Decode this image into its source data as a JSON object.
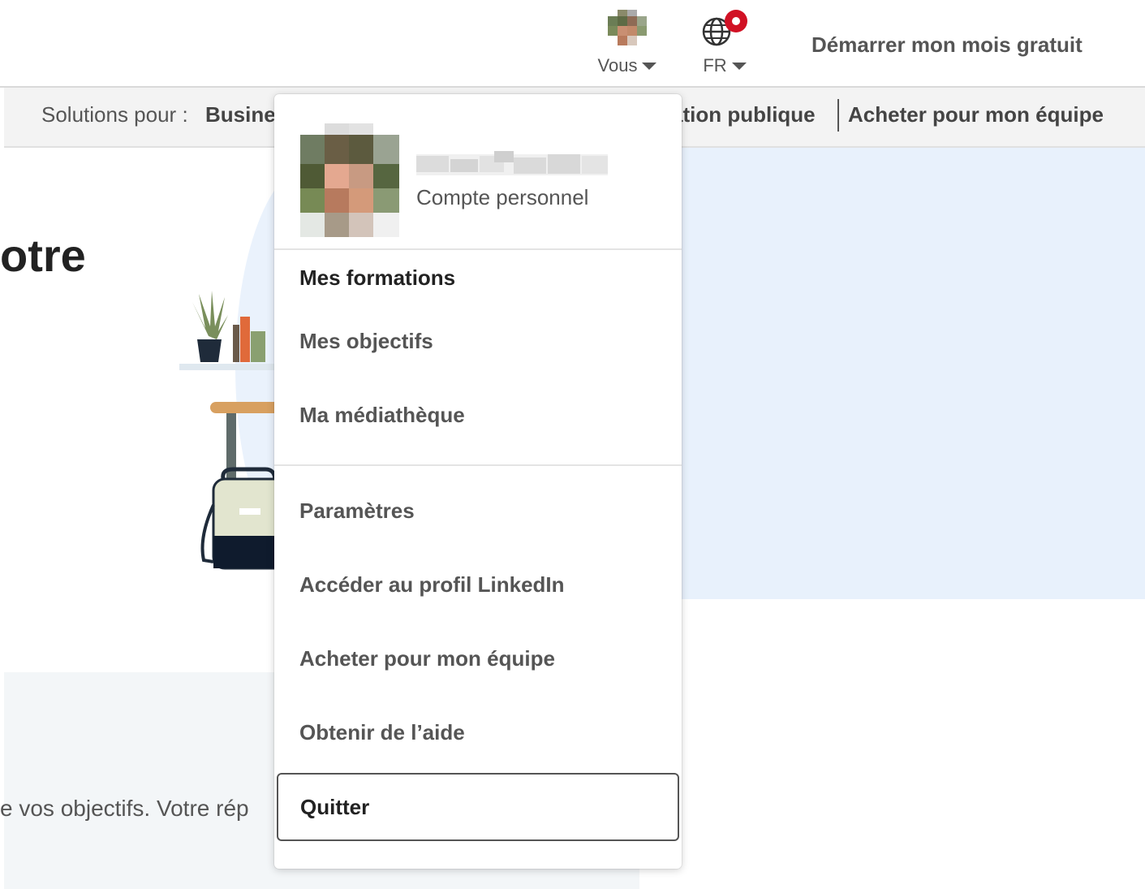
{
  "topnav": {
    "me_label": "Vous",
    "language_label": "FR",
    "trial_cta": "Démarrer mon mois gratuit"
  },
  "subnav": {
    "prefix": "Solutions pour :",
    "business": "Busine",
    "public_sector": "ation publique",
    "team": "Acheter pour mon équipe"
  },
  "hero": {
    "title_fragment": "otre",
    "body_fragment": "e vos objectifs. Votre rép"
  },
  "dropdown": {
    "account_type": "Compte personnel",
    "items": [
      {
        "label": "Mes formations"
      },
      {
        "label": "Mes objectifs"
      },
      {
        "label": "Ma médiathèque"
      },
      {
        "label": "Paramètres"
      },
      {
        "label": "Accéder au profil LinkedIn"
      },
      {
        "label": "Acheter pour mon équipe"
      },
      {
        "label": "Obtenir de l’aide"
      },
      {
        "label": "Quitter"
      }
    ]
  },
  "colors": {
    "notification": "#d11124",
    "hero_background": "#e8f1fc"
  },
  "icons": [
    "avatar",
    "caret-down-icon",
    "globe-icon",
    "notification-badge"
  ]
}
